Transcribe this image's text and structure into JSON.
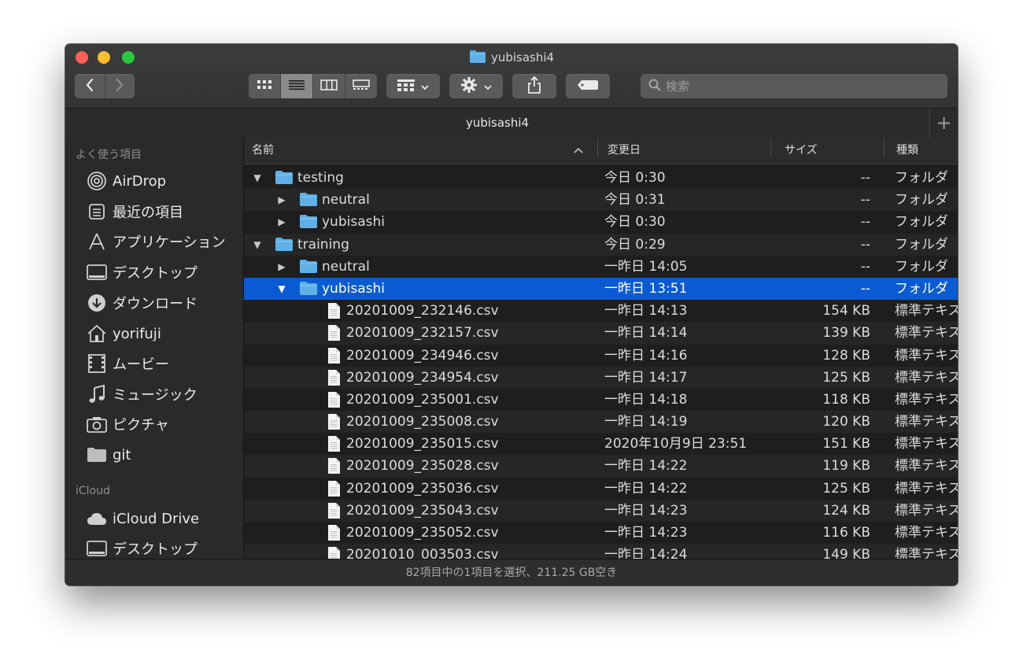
{
  "window": {
    "title": "yubisashi4"
  },
  "toolbar": {
    "back_icon": "chevron-left-icon",
    "forward_icon": "chevron-right-icon",
    "view_modes": [
      "icon-view",
      "list-view",
      "column-view",
      "gallery-view"
    ],
    "active_view": "list-view",
    "search_placeholder": "検索"
  },
  "tab": {
    "label": "yubisashi4"
  },
  "sidebar": {
    "favorites_header": "よく使う項目",
    "favorites": [
      {
        "label": "AirDrop",
        "icon": "airdrop-icon"
      },
      {
        "label": "最近の項目",
        "icon": "recents-icon"
      },
      {
        "label": "アプリケーション",
        "icon": "applications-icon"
      },
      {
        "label": "デスクトップ",
        "icon": "desktop-icon"
      },
      {
        "label": "ダウンロード",
        "icon": "downloads-icon"
      },
      {
        "label": "yorifuji",
        "icon": "home-icon"
      },
      {
        "label": "ムービー",
        "icon": "movies-icon"
      },
      {
        "label": "ミュージック",
        "icon": "music-icon"
      },
      {
        "label": "ピクチャ",
        "icon": "pictures-icon"
      },
      {
        "label": "git",
        "icon": "folder-icon"
      }
    ],
    "icloud_header": "iCloud",
    "icloud": [
      {
        "label": "iCloud Drive",
        "icon": "cloud-icon"
      },
      {
        "label": "デスクトップ",
        "icon": "desktop-icon"
      }
    ]
  },
  "columns": {
    "name": "名前",
    "date": "変更日",
    "size": "サイズ",
    "kind": "種類"
  },
  "rows": [
    {
      "name": "testing",
      "date": "今日 0:30",
      "size": "--",
      "kind": "フォルダ",
      "level": 0,
      "type": "folder",
      "expanded": true
    },
    {
      "name": "neutral",
      "date": "今日 0:31",
      "size": "--",
      "kind": "フォルダ",
      "level": 1,
      "type": "folder",
      "expanded": false
    },
    {
      "name": "yubisashi",
      "date": "今日 0:30",
      "size": "--",
      "kind": "フォルダ",
      "level": 1,
      "type": "folder",
      "expanded": false
    },
    {
      "name": "training",
      "date": "今日 0:29",
      "size": "--",
      "kind": "フォルダ",
      "level": 0,
      "type": "folder",
      "expanded": true
    },
    {
      "name": "neutral",
      "date": "一昨日 14:05",
      "size": "--",
      "kind": "フォルダ",
      "level": 1,
      "type": "folder",
      "expanded": false
    },
    {
      "name": "yubisashi",
      "date": "一昨日 13:51",
      "size": "--",
      "kind": "フォルダ",
      "level": 1,
      "type": "folder",
      "expanded": true,
      "selected": true
    },
    {
      "name": "20201009_232146.csv",
      "date": "一昨日 14:13",
      "size": "154 KB",
      "kind": "標準テキス",
      "level": 2,
      "type": "file"
    },
    {
      "name": "20201009_232157.csv",
      "date": "一昨日 14:14",
      "size": "139 KB",
      "kind": "標準テキス",
      "level": 2,
      "type": "file"
    },
    {
      "name": "20201009_234946.csv",
      "date": "一昨日 14:16",
      "size": "128 KB",
      "kind": "標準テキス",
      "level": 2,
      "type": "file"
    },
    {
      "name": "20201009_234954.csv",
      "date": "一昨日 14:17",
      "size": "125 KB",
      "kind": "標準テキス",
      "level": 2,
      "type": "file"
    },
    {
      "name": "20201009_235001.csv",
      "date": "一昨日 14:18",
      "size": "118 KB",
      "kind": "標準テキス",
      "level": 2,
      "type": "file"
    },
    {
      "name": "20201009_235008.csv",
      "date": "一昨日 14:19",
      "size": "120 KB",
      "kind": "標準テキス",
      "level": 2,
      "type": "file"
    },
    {
      "name": "20201009_235015.csv",
      "date": "2020年10月9日 23:51",
      "size": "151 KB",
      "kind": "標準テキス",
      "level": 2,
      "type": "file"
    },
    {
      "name": "20201009_235028.csv",
      "date": "一昨日 14:22",
      "size": "119 KB",
      "kind": "標準テキス",
      "level": 2,
      "type": "file"
    },
    {
      "name": "20201009_235036.csv",
      "date": "一昨日 14:22",
      "size": "125 KB",
      "kind": "標準テキス",
      "level": 2,
      "type": "file"
    },
    {
      "name": "20201009_235043.csv",
      "date": "一昨日 14:23",
      "size": "124 KB",
      "kind": "標準テキス",
      "level": 2,
      "type": "file"
    },
    {
      "name": "20201009_235052.csv",
      "date": "一昨日 14:23",
      "size": "116 KB",
      "kind": "標準テキス",
      "level": 2,
      "type": "file"
    },
    {
      "name": "20201010_003503.csv",
      "date": "一昨日 14:24",
      "size": "149 KB",
      "kind": "標準テキス",
      "level": 2,
      "type": "file"
    }
  ],
  "status": {
    "text": "82項目中の1項目を選択、211.25 GB空き"
  },
  "colors": {
    "selection": "#0a5bd3",
    "folder": "#5fb0e6",
    "background": "#1e1e1e"
  }
}
